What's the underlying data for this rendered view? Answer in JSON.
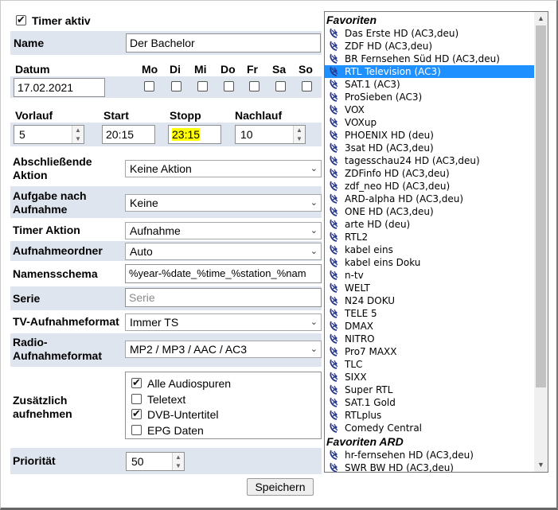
{
  "timer_active": {
    "label": "Timer aktiv",
    "checked": true
  },
  "name": {
    "label": "Name",
    "value": "Der Bachelor"
  },
  "date": {
    "label": "Datum",
    "value": "17.02.2021"
  },
  "days": [
    "Mo",
    "Di",
    "Mi",
    "Do",
    "Fr",
    "Sa",
    "So"
  ],
  "times": {
    "lead_label": "Vorlauf",
    "lead_value": "5",
    "start_label": "Start",
    "start_value": "20:15",
    "stop_label": "Stopp",
    "stop_value": "23:15",
    "trail_label": "Nachlauf",
    "trail_value": "10"
  },
  "final_action": {
    "label_1": "Abschließende",
    "label_2": "Aktion",
    "value": "Keine Aktion"
  },
  "after_task": {
    "label_1": "Aufgabe nach",
    "label_2": "Aufnahme",
    "value": "Keine"
  },
  "timer_action": {
    "label": "Timer Aktion",
    "value": "Aufnahme"
  },
  "rec_folder": {
    "label": "Aufnahmeordner",
    "value": "Auto"
  },
  "naming": {
    "label": "Namensschema",
    "value": "%year-%date_%time_%station_%nam"
  },
  "series": {
    "label": "Serie",
    "placeholder": "Serie"
  },
  "tv_format": {
    "label": "TV-Aufnahmeformat",
    "value": "Immer TS"
  },
  "radio_format": {
    "label_1": "Radio-",
    "label_2": "Aufnahmeformat",
    "value": "MP2 / MP3 / AAC / AC3"
  },
  "extra": {
    "label_1": "Zusätzlich",
    "label_2": "aufnehmen",
    "options": [
      {
        "label": "Alle Audiospuren",
        "checked": true
      },
      {
        "label": "Teletext",
        "checked": false
      },
      {
        "label": "DVB-Untertitel",
        "checked": true
      },
      {
        "label": "EPG Daten",
        "checked": false
      }
    ]
  },
  "priority": {
    "label": "Priorität",
    "value": "50"
  },
  "save_label": "Speichern",
  "channel_list": {
    "group1": "Favoriten",
    "channels": [
      "Das Erste HD (AC3,deu)",
      "ZDF HD (AC3,deu)",
      "BR Fernsehen Süd HD (AC3,deu)",
      "RTL Television (AC3)",
      "SAT.1 (AC3)",
      "ProSieben (AC3)",
      "VOX",
      "VOXup",
      "PHOENIX HD (deu)",
      "3sat HD (AC3,deu)",
      "tagesschau24 HD (AC3,deu)",
      "ZDFinfo HD (AC3,deu)",
      "zdf_neo HD (AC3,deu)",
      "ARD-alpha HD (AC3,deu)",
      "ONE HD (AC3,deu)",
      "arte HD (deu)",
      "RTL2",
      "kabel eins",
      "kabel eins Doku",
      "n-tv",
      "WELT",
      "N24 DOKU",
      "TELE 5",
      "DMAX",
      "NITRO",
      "Pro7 MAXX",
      "TLC",
      "SIXX",
      "Super RTL",
      "SAT.1 Gold",
      "RTLplus",
      "Comedy Central"
    ],
    "selected_index": 3,
    "group2": "Favoriten ARD",
    "channels2": [
      "hr-fernsehen HD (AC3,deu)",
      "SWR BW HD (AC3,deu)"
    ]
  },
  "colors": {
    "band": "#dfe5ee",
    "selection": "#1e90ff",
    "highlight": "#ffff00"
  }
}
